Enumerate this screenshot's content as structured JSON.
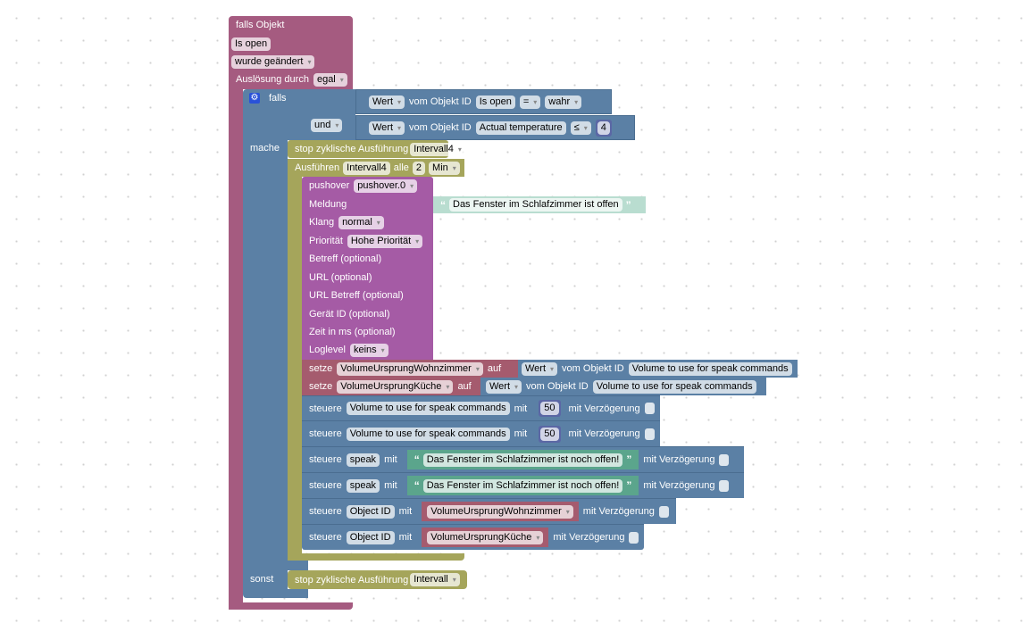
{
  "trigger": {
    "title": "falls Objekt",
    "object": "Is open",
    "event": "wurde geändert",
    "cause_label": "Auslösung durch",
    "cause": "egal"
  },
  "if_block": {
    "falls": "falls",
    "und": "und",
    "mache": "mache",
    "sonst": "sonst",
    "cond1": {
      "wert": "Wert",
      "vom": "vom Objekt ID",
      "obj": "Is open",
      "op": "=",
      "val": "wahr"
    },
    "cond2": {
      "wert": "Wert",
      "vom": "vom Objekt ID",
      "obj": "Actual temperature",
      "op": "≤",
      "val": "4"
    }
  },
  "stop1": {
    "label": "stop zyklische Ausführung",
    "interval": "Intervall4"
  },
  "run": {
    "label": "Ausführen",
    "interval": "Intervall4",
    "alle": "alle",
    "n": "2",
    "unit": "Min"
  },
  "pushover": {
    "label": "pushover",
    "instance": "pushover.0",
    "meldung": "Meldung",
    "message": "Das Fenster im Schlafzimmer ist offen",
    "klang": "Klang",
    "sound": "normal",
    "prio": "Priorität",
    "prio_val": "Hohe Priorität",
    "betreff": "Betreff (optional)",
    "url": "URL (optional)",
    "url_betreff": "URL Betreff (optional)",
    "geraet": "Gerät ID (optional)",
    "zeit": "Zeit in ms (optional)",
    "loglevel": "Loglevel",
    "loglevel_val": "keins"
  },
  "set1": {
    "setze": "setze",
    "var": "VolumeUrsprungWohnzimmer",
    "auf": "auf",
    "wert": "Wert",
    "vom": "vom Objekt ID",
    "obj": "Volume to use for speak commands"
  },
  "set2": {
    "setze": "setze",
    "var": "VolumeUrsprungKüche",
    "auf": "auf",
    "wert": "Wert",
    "vom": "vom Objekt ID",
    "obj": "Volume to use for speak commands"
  },
  "ctl": [
    {
      "steuere": "steuere",
      "obj": "Volume to use for speak commands",
      "mit": "mit",
      "val": "50",
      "delay": "mit Verzögerung"
    },
    {
      "steuere": "steuere",
      "obj": "Volume to use for speak commands",
      "mit": "mit",
      "val": "50",
      "delay": "mit Verzögerung"
    },
    {
      "steuere": "steuere",
      "obj": "speak",
      "mit": "mit",
      "val": "Das Fenster im Schlafzimmer ist noch offen!",
      "delay": "mit Verzögerung"
    },
    {
      "steuere": "steuere",
      "obj": "speak",
      "mit": "mit",
      "val": "Das Fenster im Schlafzimmer ist noch offen!",
      "delay": "mit Verzögerung"
    },
    {
      "steuere": "steuere",
      "obj": "Object ID",
      "mit": "mit",
      "val": "VolumeUrsprungWohnzimmer",
      "delay": "mit Verzögerung"
    },
    {
      "steuere": "steuere",
      "obj": "Object ID",
      "mit": "mit",
      "val": "VolumeUrsprungKüche",
      "delay": "mit Verzögerung"
    }
  ],
  "stop2": {
    "label": "stop zyklische Ausführung",
    "interval": "Intervall"
  },
  "colors": {
    "trigger": "#a55b80",
    "logic": "#5b80a5",
    "timer": "#a5a55b",
    "pushover": "#a55ba5",
    "variable": "#a55b6e",
    "text": "#5ba58c",
    "number": "#5b67a5"
  }
}
